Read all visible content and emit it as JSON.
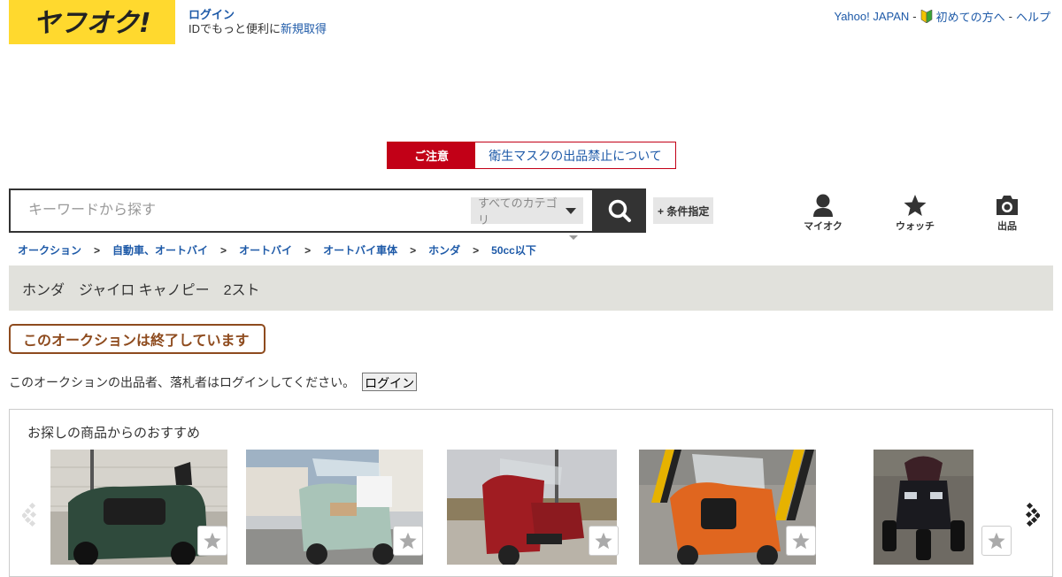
{
  "header": {
    "logo_text": "ヤフオク!",
    "login_label": "ログイン",
    "login_sub_prefix": "IDでもっと便利に",
    "register_label": "新規取得",
    "nav": {
      "yahoo_japan": "Yahoo! JAPAN",
      "sep1": "-",
      "beginners": "初めての方へ",
      "sep2": "-",
      "help": "ヘルプ"
    }
  },
  "notice": {
    "tag": "ご注意",
    "link": "衛生マスクの出品禁止について"
  },
  "search": {
    "placeholder": "キーワードから探す",
    "category": "すべてのカテゴリ",
    "conditions_button": "+ 条件指定"
  },
  "icon_nav": [
    {
      "label": "マイオク",
      "icon": "person-icon"
    },
    {
      "label": "ウォッチ",
      "icon": "star-icon"
    },
    {
      "label": "出品",
      "icon": "camera-icon"
    }
  ],
  "breadcrumb": [
    "オークション",
    "自動車、オートバイ",
    "オートバイ",
    "オートバイ車体",
    "ホンダ",
    "50cc以下"
  ],
  "breadcrumb_separator": ">",
  "item_title": "ホンダ　ジャイロ キャノピー　2スト",
  "ended_notice": "このオークションは終了しています",
  "login_message": "このオークションの出品者、落札者はログインしてください。",
  "login_button": "ログイン",
  "recommend": {
    "title": "お探しの商品からのおすすめ",
    "items": [
      {
        "name": "dark-green-canopy-scooter",
        "color": "#2f4a3c"
      },
      {
        "name": "mint-canopy-scooter",
        "color": "#a9c4b8"
      },
      {
        "name": "red-canopy-scooter",
        "color": "#a01c22"
      },
      {
        "name": "orange-canopy-scooter",
        "color": "#e0661f"
      },
      {
        "name": "black-trike-scooter",
        "color": "#1a1a1f"
      }
    ]
  },
  "colors": {
    "logo_yellow": "#ffd92e",
    "link_blue": "#1e5aa8",
    "notice_red": "#c20017",
    "ended_brown": "#8e4b1e",
    "title_band": "#e1e1dc"
  }
}
